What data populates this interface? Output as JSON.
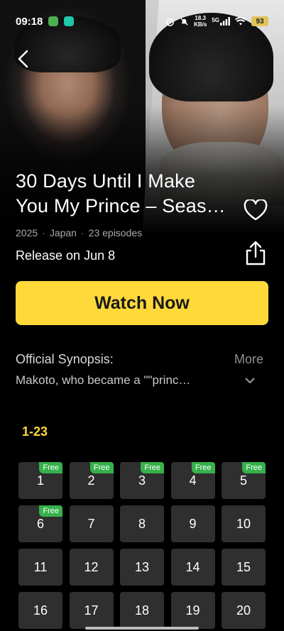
{
  "status_bar": {
    "time": "09:18",
    "net_speed_top": "18.3",
    "net_speed_unit": "KB/s",
    "network": "5G",
    "battery": "93"
  },
  "show": {
    "title_line1": "30 Days Until I Make",
    "title_line2": "You My Prince – Seas…",
    "year": "2025",
    "country": "Japan",
    "episodes": "23 episodes",
    "separator": "·",
    "release": "Release on Jun 8"
  },
  "actions": {
    "watch_label": "Watch Now"
  },
  "synopsis": {
    "label": "Official Synopsis:",
    "more_label": "More",
    "text": "Makoto, who became a \"\"princ…"
  },
  "episode_range": "1-23",
  "free_label": "Free",
  "episodes": [
    {
      "n": "1",
      "free": true
    },
    {
      "n": "2",
      "free": true
    },
    {
      "n": "3",
      "free": true
    },
    {
      "n": "4",
      "free": true
    },
    {
      "n": "5",
      "free": true
    },
    {
      "n": "6",
      "free": true
    },
    {
      "n": "7",
      "free": false
    },
    {
      "n": "8",
      "free": false
    },
    {
      "n": "9",
      "free": false
    },
    {
      "n": "10",
      "free": false
    },
    {
      "n": "11",
      "free": false
    },
    {
      "n": "12",
      "free": false
    },
    {
      "n": "13",
      "free": false
    },
    {
      "n": "14",
      "free": false
    },
    {
      "n": "15",
      "free": false
    },
    {
      "n": "16",
      "free": false
    },
    {
      "n": "17",
      "free": false
    },
    {
      "n": "18",
      "free": false
    },
    {
      "n": "19",
      "free": false
    },
    {
      "n": "20",
      "free": false
    }
  ],
  "colors": {
    "accent": "#ffd93a",
    "free_badge": "#36b14b",
    "tile": "#2f2f2f"
  }
}
